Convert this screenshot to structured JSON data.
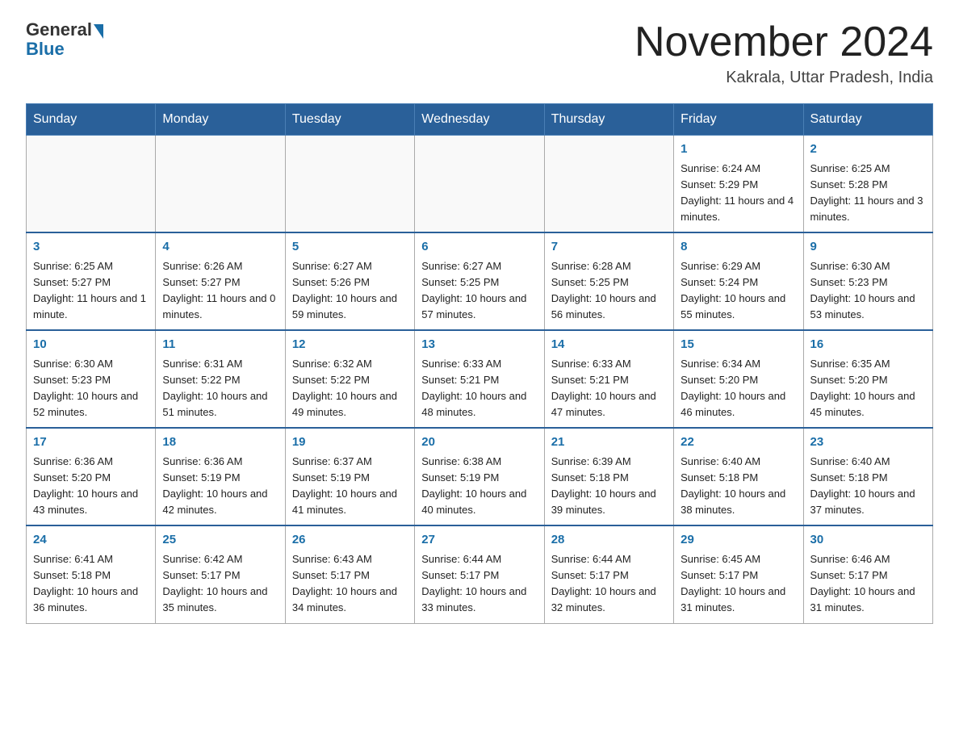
{
  "header": {
    "logo_general": "General",
    "logo_blue": "Blue",
    "title": "November 2024",
    "location": "Kakrala, Uttar Pradesh, India"
  },
  "days_of_week": [
    "Sunday",
    "Monday",
    "Tuesday",
    "Wednesday",
    "Thursday",
    "Friday",
    "Saturday"
  ],
  "weeks": [
    [
      {
        "num": "",
        "info": ""
      },
      {
        "num": "",
        "info": ""
      },
      {
        "num": "",
        "info": ""
      },
      {
        "num": "",
        "info": ""
      },
      {
        "num": "",
        "info": ""
      },
      {
        "num": "1",
        "info": "Sunrise: 6:24 AM\nSunset: 5:29 PM\nDaylight: 11 hours and 4 minutes."
      },
      {
        "num": "2",
        "info": "Sunrise: 6:25 AM\nSunset: 5:28 PM\nDaylight: 11 hours and 3 minutes."
      }
    ],
    [
      {
        "num": "3",
        "info": "Sunrise: 6:25 AM\nSunset: 5:27 PM\nDaylight: 11 hours and 1 minute."
      },
      {
        "num": "4",
        "info": "Sunrise: 6:26 AM\nSunset: 5:27 PM\nDaylight: 11 hours and 0 minutes."
      },
      {
        "num": "5",
        "info": "Sunrise: 6:27 AM\nSunset: 5:26 PM\nDaylight: 10 hours and 59 minutes."
      },
      {
        "num": "6",
        "info": "Sunrise: 6:27 AM\nSunset: 5:25 PM\nDaylight: 10 hours and 57 minutes."
      },
      {
        "num": "7",
        "info": "Sunrise: 6:28 AM\nSunset: 5:25 PM\nDaylight: 10 hours and 56 minutes."
      },
      {
        "num": "8",
        "info": "Sunrise: 6:29 AM\nSunset: 5:24 PM\nDaylight: 10 hours and 55 minutes."
      },
      {
        "num": "9",
        "info": "Sunrise: 6:30 AM\nSunset: 5:23 PM\nDaylight: 10 hours and 53 minutes."
      }
    ],
    [
      {
        "num": "10",
        "info": "Sunrise: 6:30 AM\nSunset: 5:23 PM\nDaylight: 10 hours and 52 minutes."
      },
      {
        "num": "11",
        "info": "Sunrise: 6:31 AM\nSunset: 5:22 PM\nDaylight: 10 hours and 51 minutes."
      },
      {
        "num": "12",
        "info": "Sunrise: 6:32 AM\nSunset: 5:22 PM\nDaylight: 10 hours and 49 minutes."
      },
      {
        "num": "13",
        "info": "Sunrise: 6:33 AM\nSunset: 5:21 PM\nDaylight: 10 hours and 48 minutes."
      },
      {
        "num": "14",
        "info": "Sunrise: 6:33 AM\nSunset: 5:21 PM\nDaylight: 10 hours and 47 minutes."
      },
      {
        "num": "15",
        "info": "Sunrise: 6:34 AM\nSunset: 5:20 PM\nDaylight: 10 hours and 46 minutes."
      },
      {
        "num": "16",
        "info": "Sunrise: 6:35 AM\nSunset: 5:20 PM\nDaylight: 10 hours and 45 minutes."
      }
    ],
    [
      {
        "num": "17",
        "info": "Sunrise: 6:36 AM\nSunset: 5:20 PM\nDaylight: 10 hours and 43 minutes."
      },
      {
        "num": "18",
        "info": "Sunrise: 6:36 AM\nSunset: 5:19 PM\nDaylight: 10 hours and 42 minutes."
      },
      {
        "num": "19",
        "info": "Sunrise: 6:37 AM\nSunset: 5:19 PM\nDaylight: 10 hours and 41 minutes."
      },
      {
        "num": "20",
        "info": "Sunrise: 6:38 AM\nSunset: 5:19 PM\nDaylight: 10 hours and 40 minutes."
      },
      {
        "num": "21",
        "info": "Sunrise: 6:39 AM\nSunset: 5:18 PM\nDaylight: 10 hours and 39 minutes."
      },
      {
        "num": "22",
        "info": "Sunrise: 6:40 AM\nSunset: 5:18 PM\nDaylight: 10 hours and 38 minutes."
      },
      {
        "num": "23",
        "info": "Sunrise: 6:40 AM\nSunset: 5:18 PM\nDaylight: 10 hours and 37 minutes."
      }
    ],
    [
      {
        "num": "24",
        "info": "Sunrise: 6:41 AM\nSunset: 5:18 PM\nDaylight: 10 hours and 36 minutes."
      },
      {
        "num": "25",
        "info": "Sunrise: 6:42 AM\nSunset: 5:17 PM\nDaylight: 10 hours and 35 minutes."
      },
      {
        "num": "26",
        "info": "Sunrise: 6:43 AM\nSunset: 5:17 PM\nDaylight: 10 hours and 34 minutes."
      },
      {
        "num": "27",
        "info": "Sunrise: 6:44 AM\nSunset: 5:17 PM\nDaylight: 10 hours and 33 minutes."
      },
      {
        "num": "28",
        "info": "Sunrise: 6:44 AM\nSunset: 5:17 PM\nDaylight: 10 hours and 32 minutes."
      },
      {
        "num": "29",
        "info": "Sunrise: 6:45 AM\nSunset: 5:17 PM\nDaylight: 10 hours and 31 minutes."
      },
      {
        "num": "30",
        "info": "Sunrise: 6:46 AM\nSunset: 5:17 PM\nDaylight: 10 hours and 31 minutes."
      }
    ]
  ]
}
